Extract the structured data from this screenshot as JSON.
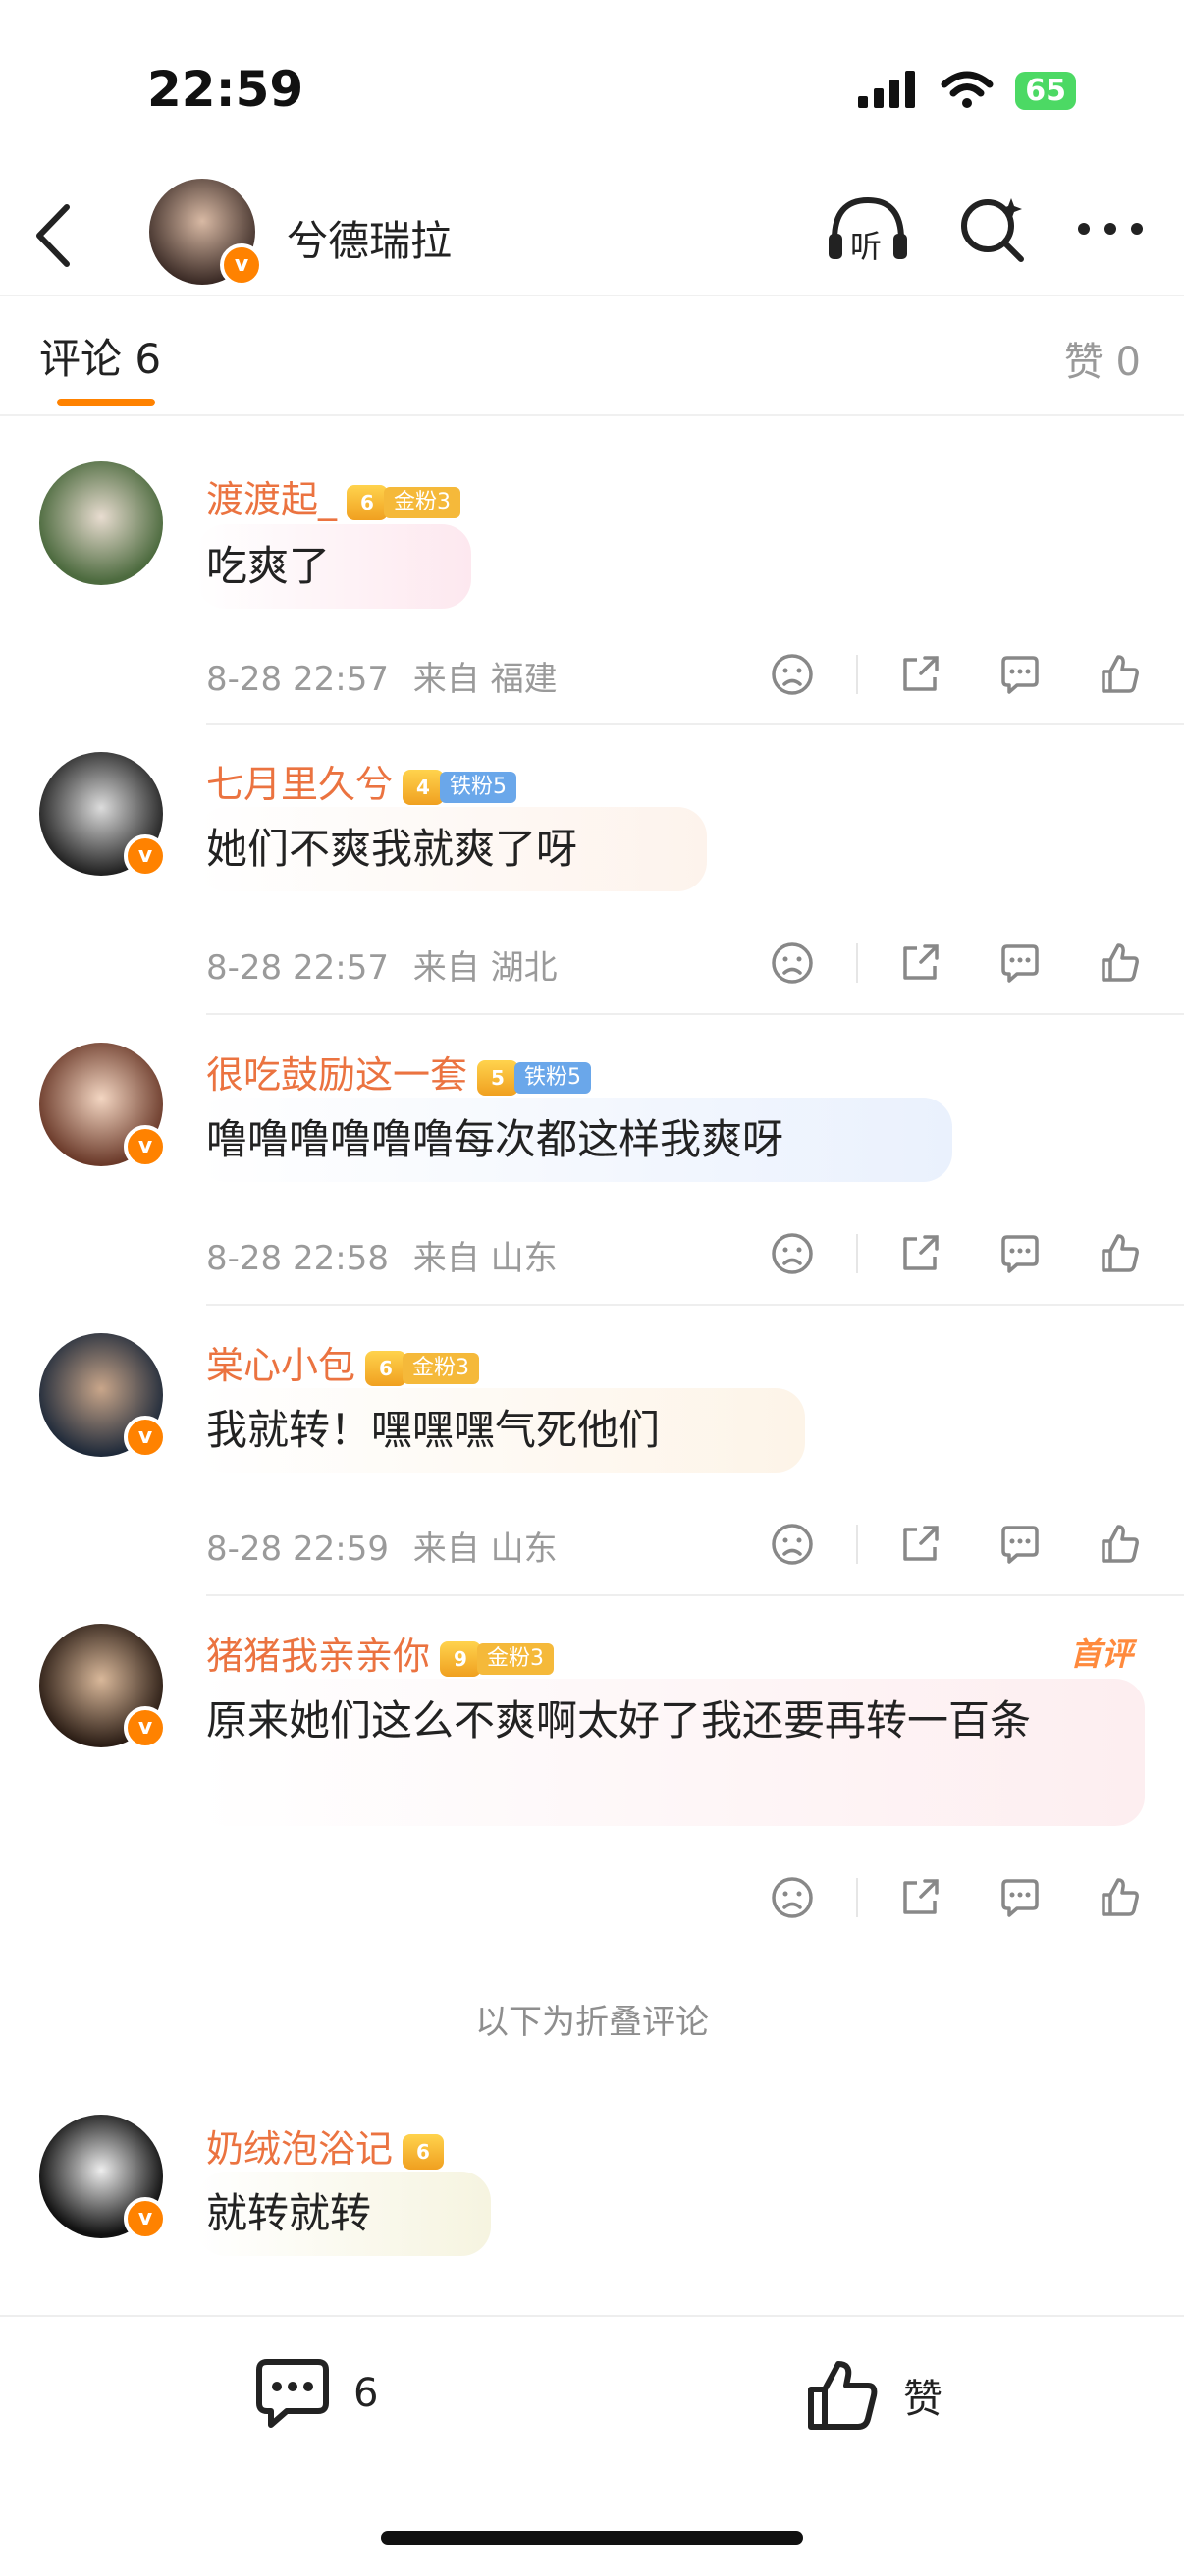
{
  "status_bar": {
    "time": "22:59",
    "battery": "65"
  },
  "header": {
    "title": "兮德瑞拉",
    "listen_label": "听",
    "verified_badge": "v"
  },
  "tabs": {
    "comments_label": "评论 6",
    "likes_label": "赞 0"
  },
  "comments": [
    {
      "username": "渡渡起_",
      "fan_level": "6",
      "fan_label": "金粉3",
      "text": "吃爽了",
      "time": "8-28 22:57",
      "location": "来自 福建"
    },
    {
      "username": "七月里久兮",
      "fan_level": "4",
      "fan_label": "铁粉5",
      "text": "她们不爽我就爽了呀",
      "time": "8-28 22:57",
      "location": "来自 湖北"
    },
    {
      "username": "很吃鼓励这一套",
      "fan_level": "5",
      "fan_label": "铁粉5",
      "text": "噜噜噜噜噜噜每次都这样我爽呀",
      "time": "8-28 22:58",
      "location": "来自 山东"
    },
    {
      "username": "棠心小包",
      "fan_level": "6",
      "fan_label": "金粉3",
      "text": "我就转！嘿嘿嘿气死他们",
      "time": "8-28 22:59",
      "location": "来自 山东"
    },
    {
      "username": "猪猪我亲亲你",
      "fan_level": "9",
      "fan_label": "金粉3",
      "text": "原来她们这么不爽啊太好了我还要再转一百条",
      "tag": "首评"
    },
    {
      "username": "奶绒泡浴记",
      "fan_level": "6",
      "text": "就转就转"
    }
  ],
  "folded_label": "以下为折叠评论",
  "bottom_bar": {
    "comment_count": "6",
    "like_label": "赞"
  },
  "colors": {
    "accent": "#ff8200",
    "username": "#eb7340",
    "meta": "#9a9a9a"
  }
}
